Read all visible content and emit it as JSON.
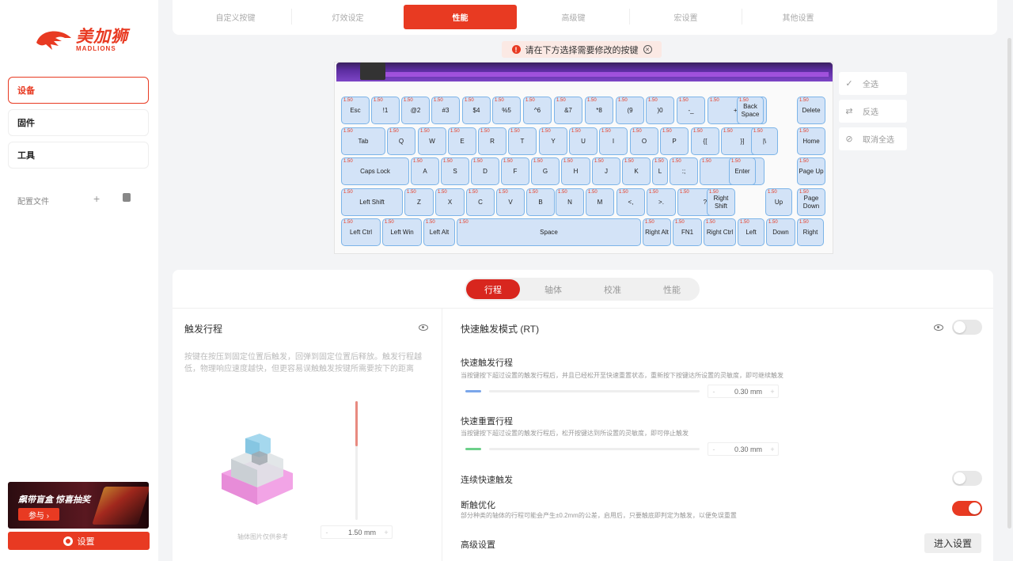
{
  "app": {
    "brand_cn": "美加狮",
    "brand_en": "MADLIONS"
  },
  "sidebar": {
    "items": [
      {
        "label": "设备"
      },
      {
        "label": "固件"
      },
      {
        "label": "工具"
      }
    ],
    "config_label": "配置文件",
    "config_add": "+",
    "promo_title": "飙带盲盒 惊喜抽奖",
    "promo_button": "参与 ›",
    "settings_label": "设置"
  },
  "top_tabs": [
    {
      "label": "自定义按键"
    },
    {
      "label": "灯效设定"
    },
    {
      "label": "性能"
    },
    {
      "label": "高级键"
    },
    {
      "label": "宏设置"
    },
    {
      "label": "其他设置"
    }
  ],
  "alert": {
    "text": "请在下方选择需要修改的按键",
    "icon": "!",
    "close": "✕"
  },
  "keyboard": {
    "rows": [
      [
        {
          "label": "Esc",
          "value": "1.50"
        },
        {
          "label": "!1",
          "value": "1.50"
        },
        {
          "label": "@2",
          "value": "1.50"
        },
        {
          "label": "#3",
          "value": "1.50"
        },
        {
          "label": "$4",
          "value": "1.50"
        },
        {
          "label": "%5",
          "value": "1.50"
        },
        {
          "label": "^6",
          "value": "1.50"
        },
        {
          "label": "&7",
          "value": "1.50"
        },
        {
          "label": "*8",
          "value": "1.50"
        },
        {
          "label": "(9",
          "value": "1.50"
        },
        {
          "label": ")0",
          "value": "1.50"
        },
        {
          "label": "-_",
          "value": "1.50"
        },
        {
          "label": "+=",
          "value": "1.50"
        },
        {
          "label": "Back Space",
          "value": "1.50"
        },
        {
          "label": "Delete",
          "value": "1.50"
        }
      ],
      [
        {
          "label": "Tab",
          "value": "1.50"
        },
        {
          "label": "Q",
          "value": "1.50"
        },
        {
          "label": "W",
          "value": "1.50"
        },
        {
          "label": "E",
          "value": "1.50"
        },
        {
          "label": "R",
          "value": "1.50"
        },
        {
          "label": "T",
          "value": "1.50"
        },
        {
          "label": "Y",
          "value": "1.50"
        },
        {
          "label": "U",
          "value": "1.50"
        },
        {
          "label": "I",
          "value": "1.50"
        },
        {
          "label": "O",
          "value": "1.50"
        },
        {
          "label": "P",
          "value": "1.50"
        },
        {
          "label": "{[",
          "value": "1.50"
        },
        {
          "label": "}]",
          "value": "1.50"
        },
        {
          "label": "|\\",
          "value": "1.50"
        },
        {
          "label": "Home",
          "value": "1.50"
        }
      ],
      [
        {
          "label": "Caps Lock",
          "value": "1.50"
        },
        {
          "label": "A",
          "value": "1.50"
        },
        {
          "label": "S",
          "value": "1.50"
        },
        {
          "label": "D",
          "value": "1.50"
        },
        {
          "label": "F",
          "value": "1.50"
        },
        {
          "label": "G",
          "value": "1.50"
        },
        {
          "label": "H",
          "value": "1.50"
        },
        {
          "label": "J",
          "value": "1.50"
        },
        {
          "label": "K",
          "value": "1.50"
        },
        {
          "label": "L",
          "value": "1.50"
        },
        {
          "label": ":;",
          "value": "1.50"
        },
        {
          "label": "\"'",
          "value": "1.50"
        },
        {
          "label": "Enter",
          "value": "1.50"
        },
        {
          "label": "Page Up",
          "value": "1.50"
        }
      ],
      [
        {
          "label": "Left Shift",
          "value": "1.50"
        },
        {
          "label": "Z",
          "value": "1.50"
        },
        {
          "label": "X",
          "value": "1.50"
        },
        {
          "label": "C",
          "value": "1.50"
        },
        {
          "label": "V",
          "value": "1.50"
        },
        {
          "label": "B",
          "value": "1.50"
        },
        {
          "label": "N",
          "value": "1.50"
        },
        {
          "label": "M",
          "value": "1.50"
        },
        {
          "label": "<,",
          "value": "1.50"
        },
        {
          "label": ">.",
          "value": "1.50"
        },
        {
          "label": "?/",
          "value": "1.50"
        },
        {
          "label": "Right Shift",
          "value": "1.50"
        },
        {
          "label": "Up",
          "value": "1.50"
        },
        {
          "label": "Page Down",
          "value": "1.50"
        }
      ],
      [
        {
          "label": "Left Ctrl",
          "value": "1.50"
        },
        {
          "label": "Left Win",
          "value": "1.50"
        },
        {
          "label": "Left Alt",
          "value": "1.50"
        },
        {
          "label": "Space",
          "value": "1.50"
        },
        {
          "label": "Right Alt",
          "value": "1.50"
        },
        {
          "label": "FN1",
          "value": "1.50"
        },
        {
          "label": "Right Ctrl",
          "value": "1.50"
        },
        {
          "label": "Left",
          "value": "1.50"
        },
        {
          "label": "Down",
          "value": "1.50"
        },
        {
          "label": "Right",
          "value": "1.50"
        }
      ]
    ]
  },
  "side_actions": [
    {
      "label": "全选",
      "icon": "✓"
    },
    {
      "label": "反选",
      "icon": "⇄"
    },
    {
      "label": "取消全选",
      "icon": "⊘"
    }
  ],
  "sub_tabs": [
    {
      "label": "行程"
    },
    {
      "label": "轴体"
    },
    {
      "label": "校准"
    },
    {
      "label": "性能"
    }
  ],
  "actuation": {
    "title": "触发行程",
    "desc": "按键在按压到固定位置后触发，回弹到固定位置后释放。触发行程越低，物理响应速度越快，但更容易误触触发按键所需要按下的距离",
    "image_caption": "轴体图片仅供参考",
    "value": "1.50",
    "unit": "mm",
    "minus": "-",
    "plus": "+"
  },
  "rt": {
    "title": "快速触发模式 (RT)",
    "enabled": false,
    "press_title": "快速触发行程",
    "press_desc": "当按键按下超过设置的触发行程后，并且已经松开至快速重置状态，重新按下按键达所设置的灵敏度，即可继续触发",
    "press_value": "0.30",
    "release_title": "快速重置行程",
    "release_desc": "当按键按下超过设置的触发行程后，松开按键达到所设置的灵敏度，即可停止触发",
    "release_value": "0.30",
    "unit": "mm",
    "minus": "-",
    "plus": "+",
    "continuous_title": "连续快速触发",
    "continuous_enabled": false,
    "bottom_title": "断触优化",
    "bottom_desc": "部分种类的轴体的行程可能会产生±0.2mm的公差，启用后，只要触底即判定为触发，以便免误重置",
    "bottom_enabled": true,
    "advanced_label": "高级设置",
    "enter_label": "进入设置"
  },
  "colors": {
    "accent": "#e83a22",
    "key_fill": "#d3e3f7",
    "key_border": "#7cb4e8",
    "press_bar": "#7aa6ea",
    "release_bar": "#6cd08a"
  }
}
